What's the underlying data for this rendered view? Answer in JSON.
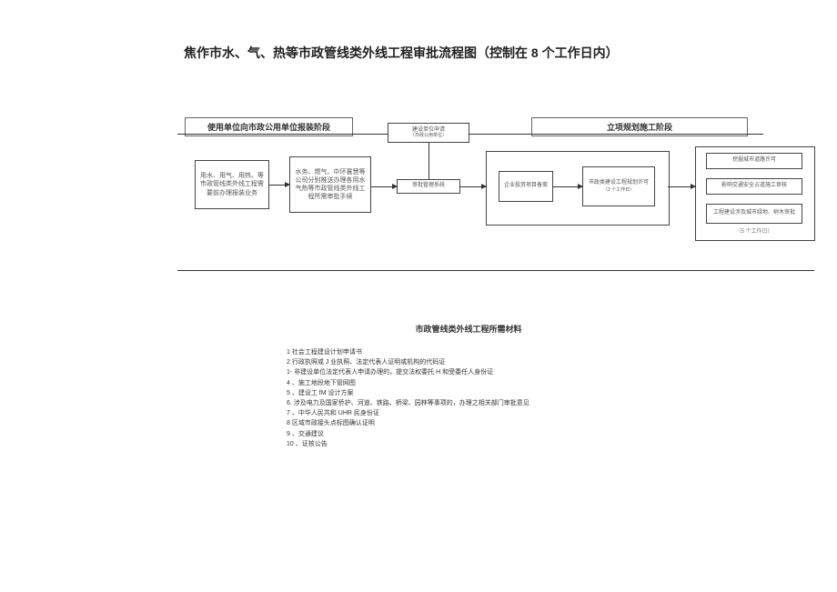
{
  "title": "焦作市水、气、热等市政管线类外线工程审批流程图（控制在 8 个工作日内）",
  "phase1": "使用单位向市政公用单位报装阶段",
  "phase2": "立项规划施工阶段",
  "topnode": {
    "label": "建设单位申请",
    "sub": "（市政公用单位）"
  },
  "n1": "用水、用气、用热、等市政管线类外线工程需要前办理报装业务",
  "n2": "水务、燃气、中环寰慧等公司分别推送办理各用水气热等市政管线类外线工程所需审批手续",
  "n3": "审批管理系统",
  "n4": "企业投资项目备案",
  "n5": {
    "label": "市政类建设工程规划许可",
    "sub": "（3 个工作日）"
  },
  "n6": "挖掘城市道路许可",
  "n7": "影响交通安全占道施工审核",
  "n8": "工程建设涉及城市绿地、树木审批",
  "n9sub": "（5 个工作日）",
  "materials_title": "市政管线类外线工程所需材料",
  "materials": [
    "1    社会工程建设计划申请书",
    "2    行政执照或 J 业执照、法定代表人证明或机构的代码证",
    "1-    非建设单位法定代表人申请办理的，提交法权委托 H 和受委任人身份证",
    "4    、施工地段地下管网图",
    "5    、建设工 fM 设计方案",
    "6.    涉及电力及国家侨护、河道、铁路、桥梁、园林等事项的，办理之相关部门审批意见",
    "7    、中华人民共和 UHR 民身份证",
    "8    区域市政接头点标图确认证明",
    "9      、交通建议",
    "10    、证核公告"
  ]
}
